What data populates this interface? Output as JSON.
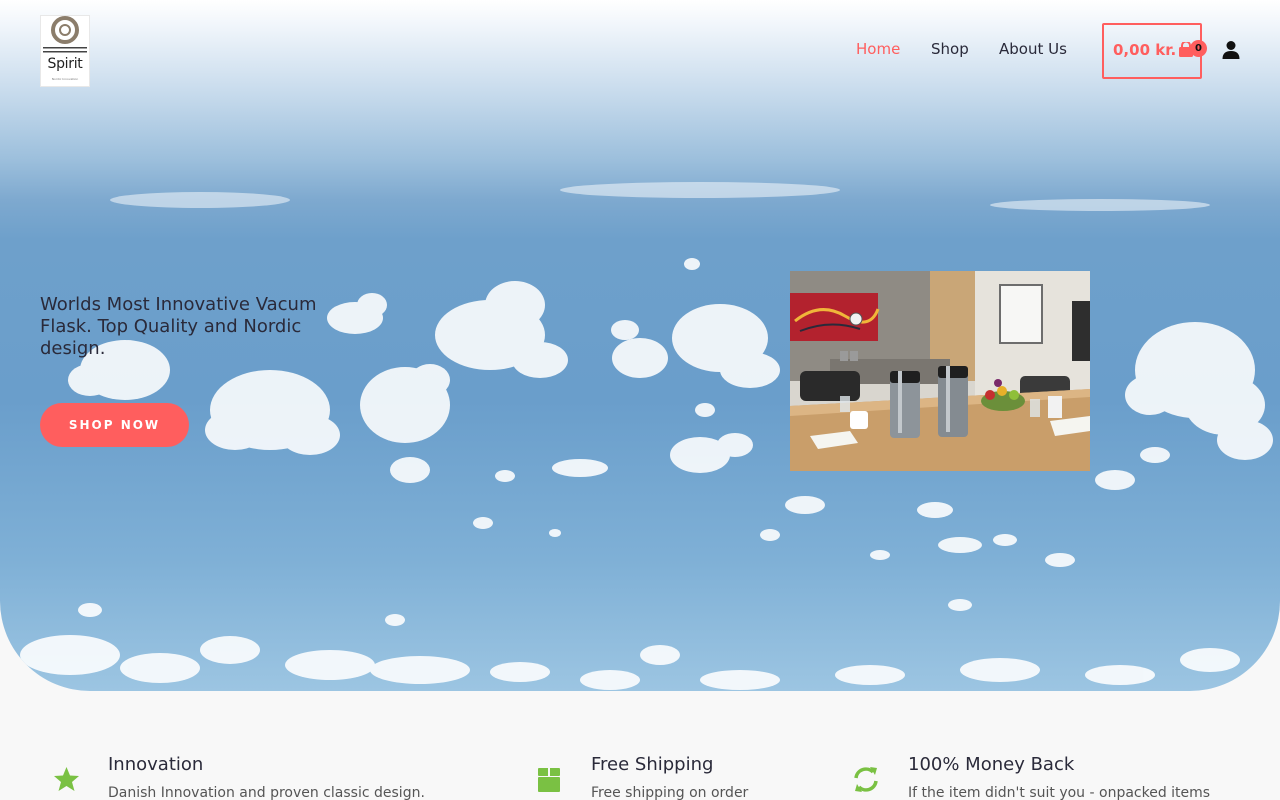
{
  "brand": {
    "logo_text": "Spirit",
    "logo_subtext": "Nordic Innovation"
  },
  "nav": {
    "home": "Home",
    "shop": "Shop",
    "about": "About Us"
  },
  "cart": {
    "total": "0,00 kr.",
    "count": "0"
  },
  "hero": {
    "headline": "Worlds Most Innovative Vacum Flask. Top Quality and Nordic design.",
    "cta": "SHOP NOW"
  },
  "features": [
    {
      "icon": "star-icon",
      "title": "Innovation",
      "description": "Danish Innovation and proven classic design."
    },
    {
      "icon": "box-icon",
      "title": "Free Shipping",
      "description": "Free shipping on order"
    },
    {
      "icon": "refresh-icon",
      "title": "100% Money Back",
      "description": "If the item didn't suit you - onpacked items"
    }
  ],
  "colors": {
    "accent": "#ff5e5e",
    "feature_icon": "#7ac143",
    "text": "#2a2a3a"
  }
}
